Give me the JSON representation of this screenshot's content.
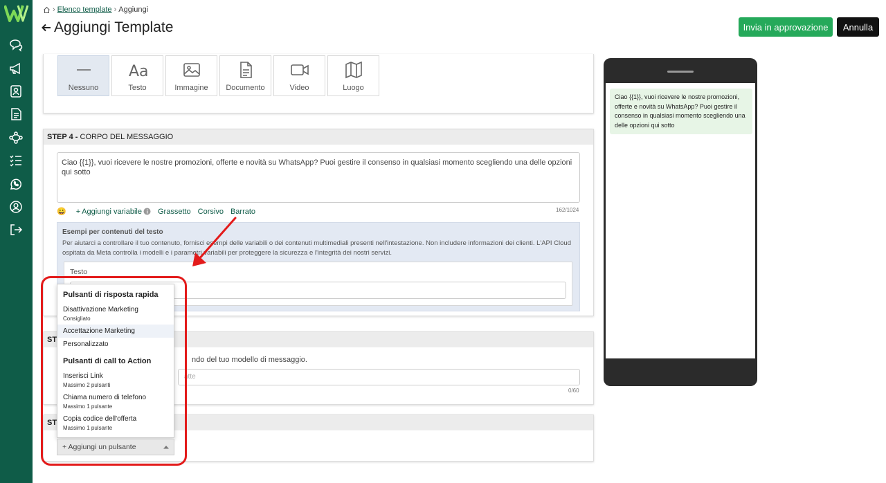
{
  "breadcrumb": {
    "link": "Elenco template",
    "current": "Aggiungi"
  },
  "page": {
    "title": "Aggiungi Template"
  },
  "header": {
    "approve_label": "Invia in approvazione",
    "cancel_label": "Annulla"
  },
  "media": {
    "tiles": [
      {
        "label": "Nessuno",
        "icon": "minus-icon",
        "selected": true
      },
      {
        "label": "Testo",
        "icon": "text-aa-icon"
      },
      {
        "label": "Immagine",
        "icon": "image-icon"
      },
      {
        "label": "Documento",
        "icon": "document-icon"
      },
      {
        "label": "Video",
        "icon": "video-icon"
      },
      {
        "label": "Luogo",
        "icon": "map-icon"
      }
    ]
  },
  "step4": {
    "prefix": "STEP 4 -",
    "title": "CORPO DEL MESSAGGIO",
    "body_text": "Ciao {{1}}, vuoi ricevere le nostre promozioni, offerte e novità su WhatsApp? Puoi gestire il consenso in qualsiasi momento scegliendo una delle opzioni qui sotto",
    "add_variable": "Aggiungi variabile",
    "bold": "Grassetto",
    "italic": "Corsivo",
    "strike": "Barrato",
    "counter": "162/1024",
    "examples_title": "Esempi per contenuti del testo",
    "examples_desc": "Per aiutarci a controllare il tuo contenuto, fornisci esempi delle variabili o dei contenuti multimediali presenti nell'intestazione. Non includere informazioni dei clienti. L'API Cloud ospitata da Meta controlla i modelli e i parametri variabili per proteggere la sicurezza e l'integrità dei nostri servizi.",
    "examples_field_label": "Testo"
  },
  "step5": {
    "head": "ST",
    "desc": "ndo del tuo modello di messaggio.",
    "placeholder": "atte",
    "counter": "0/60"
  },
  "step6": {
    "head": "ST"
  },
  "dropdown": {
    "section1": "Pulsanti di risposta rapida",
    "quick_replies": [
      {
        "label": "Disattivazione Marketing",
        "sub": "Consigliato"
      },
      {
        "label": "Accettazione Marketing",
        "sub": ""
      },
      {
        "label": "Personalizzato",
        "sub": ""
      }
    ],
    "section2": "Pulsanti di call to Action",
    "cta": [
      {
        "label": "Inserisci Link",
        "sub": "Massimo 2 pulsanti"
      },
      {
        "label": "Chiama numero di telefono",
        "sub": "Massimo 1 pulsante"
      },
      {
        "label": "Copia codice dell'offerta",
        "sub": "Massimo 1 pulsante"
      }
    ],
    "add_button": "+ Aggiungi un pulsante"
  },
  "preview": {
    "message": "Ciao {{1}}, vuoi ricevere le nostre promozioni, offerte e novità su WhatsApp? Puoi gestire il consenso in qualsiasi momento scegliendo una delle opzioni qui sotto"
  },
  "colors": {
    "sidebar": "#0f5c48",
    "accent": "#25a95a",
    "highlight": "#e31b1b"
  }
}
